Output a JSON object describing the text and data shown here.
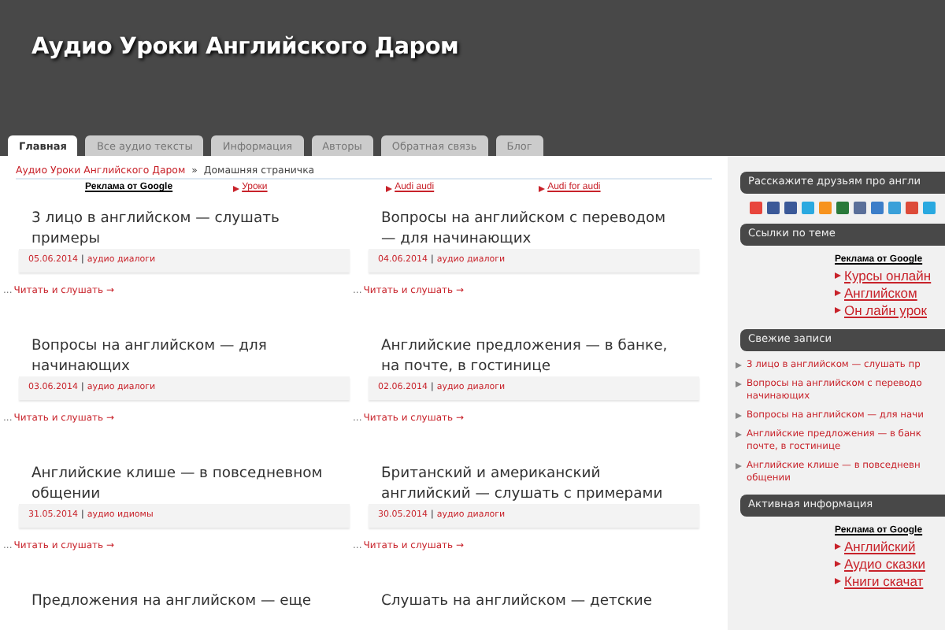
{
  "site_title": "Аудио Уроки Английского Даром",
  "tabs": [
    {
      "label": "Главная",
      "selected": true
    },
    {
      "label": "Все аудио тексты",
      "selected": false
    },
    {
      "label": "Информация",
      "selected": false
    },
    {
      "label": "Авторы",
      "selected": false
    },
    {
      "label": "Обратная связь",
      "selected": false
    },
    {
      "label": "Блог",
      "selected": false
    }
  ],
  "breadcrumb": {
    "home": "Аудио Уроки Английского Даром",
    "separator": "»",
    "current": "Домашняя страничка"
  },
  "top_ads": {
    "label": "Реклама от Google",
    "links": [
      "Уроки",
      "Audi audi",
      "Audi for audi"
    ]
  },
  "posts": [
    {
      "title": "3 лицо в английском — слушать примеры",
      "date": "05.06.2014",
      "separator": "|",
      "category": "аудио диалоги",
      "ellipsis": "...",
      "more": "Читать и слушать →"
    },
    {
      "title": "Вопросы на английском с переводом — для начинающих",
      "date": "04.06.2014",
      "separator": "|",
      "category": "аудио диалоги",
      "ellipsis": "...",
      "more": "Читать и слушать →"
    },
    {
      "title": "Вопросы на английском — для начинающих",
      "date": "03.06.2014",
      "separator": "|",
      "category": "аудио диалоги",
      "ellipsis": "...",
      "more": "Читать и слушать →"
    },
    {
      "title": "Английские предложения — в банке, на почте, в гостинице",
      "date": "02.06.2014",
      "separator": "|",
      "category": "аудио диалоги",
      "ellipsis": "...",
      "more": "Читать и слушать →"
    },
    {
      "title": "Английские клише — в повседневном общении",
      "date": "31.05.2014",
      "separator": "|",
      "category": "аудио идиомы",
      "ellipsis": "...",
      "more": "Читать и слушать →"
    },
    {
      "title": "Британский и американский английский — слушать с примерами",
      "date": "30.05.2014",
      "separator": "|",
      "category": "аудио диалоги",
      "ellipsis": "...",
      "more": "Читать и слушать →"
    },
    {
      "title": "Предложения на английском — еще"
    },
    {
      "title": "Слушать на английском — детские"
    }
  ],
  "sidebar": [
    {
      "kind": "share",
      "title": "Расскажите друзьям про англи",
      "icons": [
        {
          "color": "#e8453c"
        },
        {
          "color": "#3b5998"
        },
        {
          "color": "#3b5998"
        },
        {
          "color": "#2aa9e0"
        },
        {
          "color": "#f7931e"
        },
        {
          "color": "#2a7a3a"
        },
        {
          "color": "#5a6f99"
        },
        {
          "color": "#3c7ec9"
        },
        {
          "color": "#3aa0d9"
        },
        {
          "color": "#dd4b39"
        },
        {
          "color": "#2aa9e0"
        }
      ]
    },
    {
      "kind": "ads",
      "title": "Ссылки по теме",
      "label": "Реклама от Google",
      "links": [
        "Курсы онлайн",
        "Английском",
        "Он лайн урок"
      ]
    },
    {
      "kind": "recent",
      "title": "Свежие записи",
      "items": [
        [
          "3 лицо в английском — слушать пр"
        ],
        [
          "Вопросы на английском с переводо",
          "начинающих"
        ],
        [
          "Вопросы на английском — для начи"
        ],
        [
          "Английские предложения — в банк",
          "почте, в гостинице"
        ],
        [
          "Английские клише — в повседневн",
          "общении"
        ]
      ]
    },
    {
      "kind": "ads",
      "title": "Активная информация",
      "label": "Реклама от Google",
      "links": [
        "Английский",
        "Аудио сказки",
        "Книги скачат"
      ]
    }
  ]
}
